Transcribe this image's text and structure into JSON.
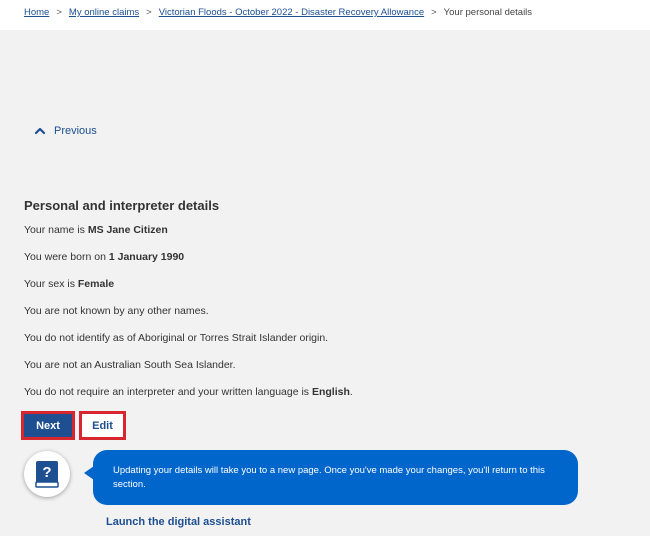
{
  "breadcrumb": {
    "items": [
      {
        "label": "Home"
      },
      {
        "label": "My online claims"
      },
      {
        "label": "Victorian Floods - October 2022 - Disaster Recovery Allowance"
      }
    ],
    "separator": ">",
    "current": "Your personal details"
  },
  "previous": {
    "label": "Previous",
    "icon": "chevron-up-icon"
  },
  "section": {
    "title": "Personal and interpreter details",
    "name_prefix": "Your name is ",
    "name_value": "MS Jane Citizen",
    "dob_prefix": "You were born on ",
    "dob_value": "1 January 1990",
    "sex_prefix": "Your sex is ",
    "sex_value": "Female",
    "other_names": "You are not known by any other names.",
    "indigenous": "You do not identify as of Aboriginal or Torres Strait Islander origin.",
    "south_sea": "You are not an Australian South Sea Islander.",
    "interpreter_prefix": "You do not require an interpreter and your written language is ",
    "interpreter_value": "English",
    "interpreter_suffix": "."
  },
  "actions": {
    "next_label": "Next",
    "edit_label": "Edit"
  },
  "assistant": {
    "icon": "help-book-icon",
    "message": "Updating your details will take you to a new page. Once you've made your changes, you'll return to this section.",
    "launch_label": "Launch the digital assistant"
  },
  "colors": {
    "brand": "#1d4f91",
    "bubble": "#0066cc",
    "highlight": "#d7262e",
    "background": "#f2f2f2"
  }
}
